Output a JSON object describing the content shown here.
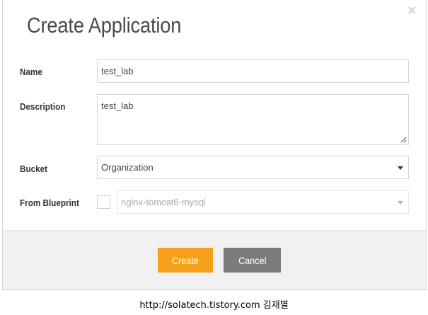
{
  "dialog": {
    "title": "Create Application",
    "close_icon": "close-icon"
  },
  "form": {
    "name": {
      "label": "Name",
      "value": "test_lab"
    },
    "description": {
      "label": "Description",
      "value": "test_lab"
    },
    "bucket": {
      "label": "Bucket",
      "selected": "Organization"
    },
    "blueprint": {
      "label": "From Blueprint",
      "checked": false,
      "selected": "nginx-tomcat6-mysql"
    }
  },
  "footer": {
    "create_label": "Create",
    "cancel_label": "Cancel"
  },
  "colors": {
    "create": "#f7a11a",
    "cancel": "#7c7c7c",
    "footer_bg": "#f1f1f1"
  },
  "caption": "http://solatech.tistory.com 김재별"
}
